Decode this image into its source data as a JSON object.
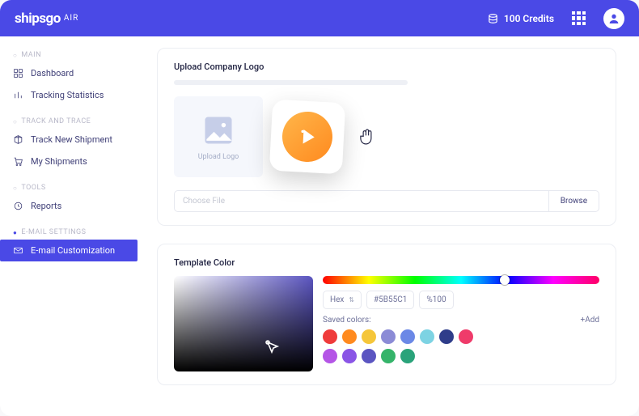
{
  "header": {
    "brand": "shipsgo",
    "brand_suffix": "AIR",
    "credits_label": "100 Credits"
  },
  "sidebar": {
    "sections": [
      {
        "label": "MAIN",
        "active": false,
        "items": [
          {
            "label": "Dashboard",
            "icon": "dashboard-icon"
          },
          {
            "label": "Tracking Statistics",
            "icon": "stats-icon"
          }
        ]
      },
      {
        "label": "TRACK AND TRACE",
        "active": false,
        "items": [
          {
            "label": "Track New Shipment",
            "icon": "package-icon"
          },
          {
            "label": "My Shipments",
            "icon": "cart-icon"
          }
        ]
      },
      {
        "label": "TOOLS",
        "active": false,
        "items": [
          {
            "label": "Reports",
            "icon": "clock-icon"
          }
        ]
      },
      {
        "label": "E-MAIL SETTINGS",
        "active": true,
        "items": [
          {
            "label": "E-mail Customization",
            "icon": "mail-icon",
            "active": true
          }
        ]
      }
    ]
  },
  "upload": {
    "title": "Upload Company Logo",
    "box_text": "Upload Logo",
    "file_placeholder": "Choose File",
    "browse": "Browse"
  },
  "color": {
    "title": "Template Color",
    "mode": "Hex",
    "hex": "#5B55C1",
    "opacity": "%100",
    "saved_label": "Saved colors:",
    "add_label": "+Add",
    "hue_handle_pct": 64,
    "swatches": [
      "#ef3b3b",
      "#ff8a1f",
      "#f5c63a",
      "#8b8bd6",
      "#6b88e6",
      "#7dd3e3",
      "#2f3d8a",
      "#ef3b6a",
      "#b455e6",
      "#8a55e6",
      "#5b55c1",
      "#35b46a",
      "#2aa37a"
    ]
  }
}
